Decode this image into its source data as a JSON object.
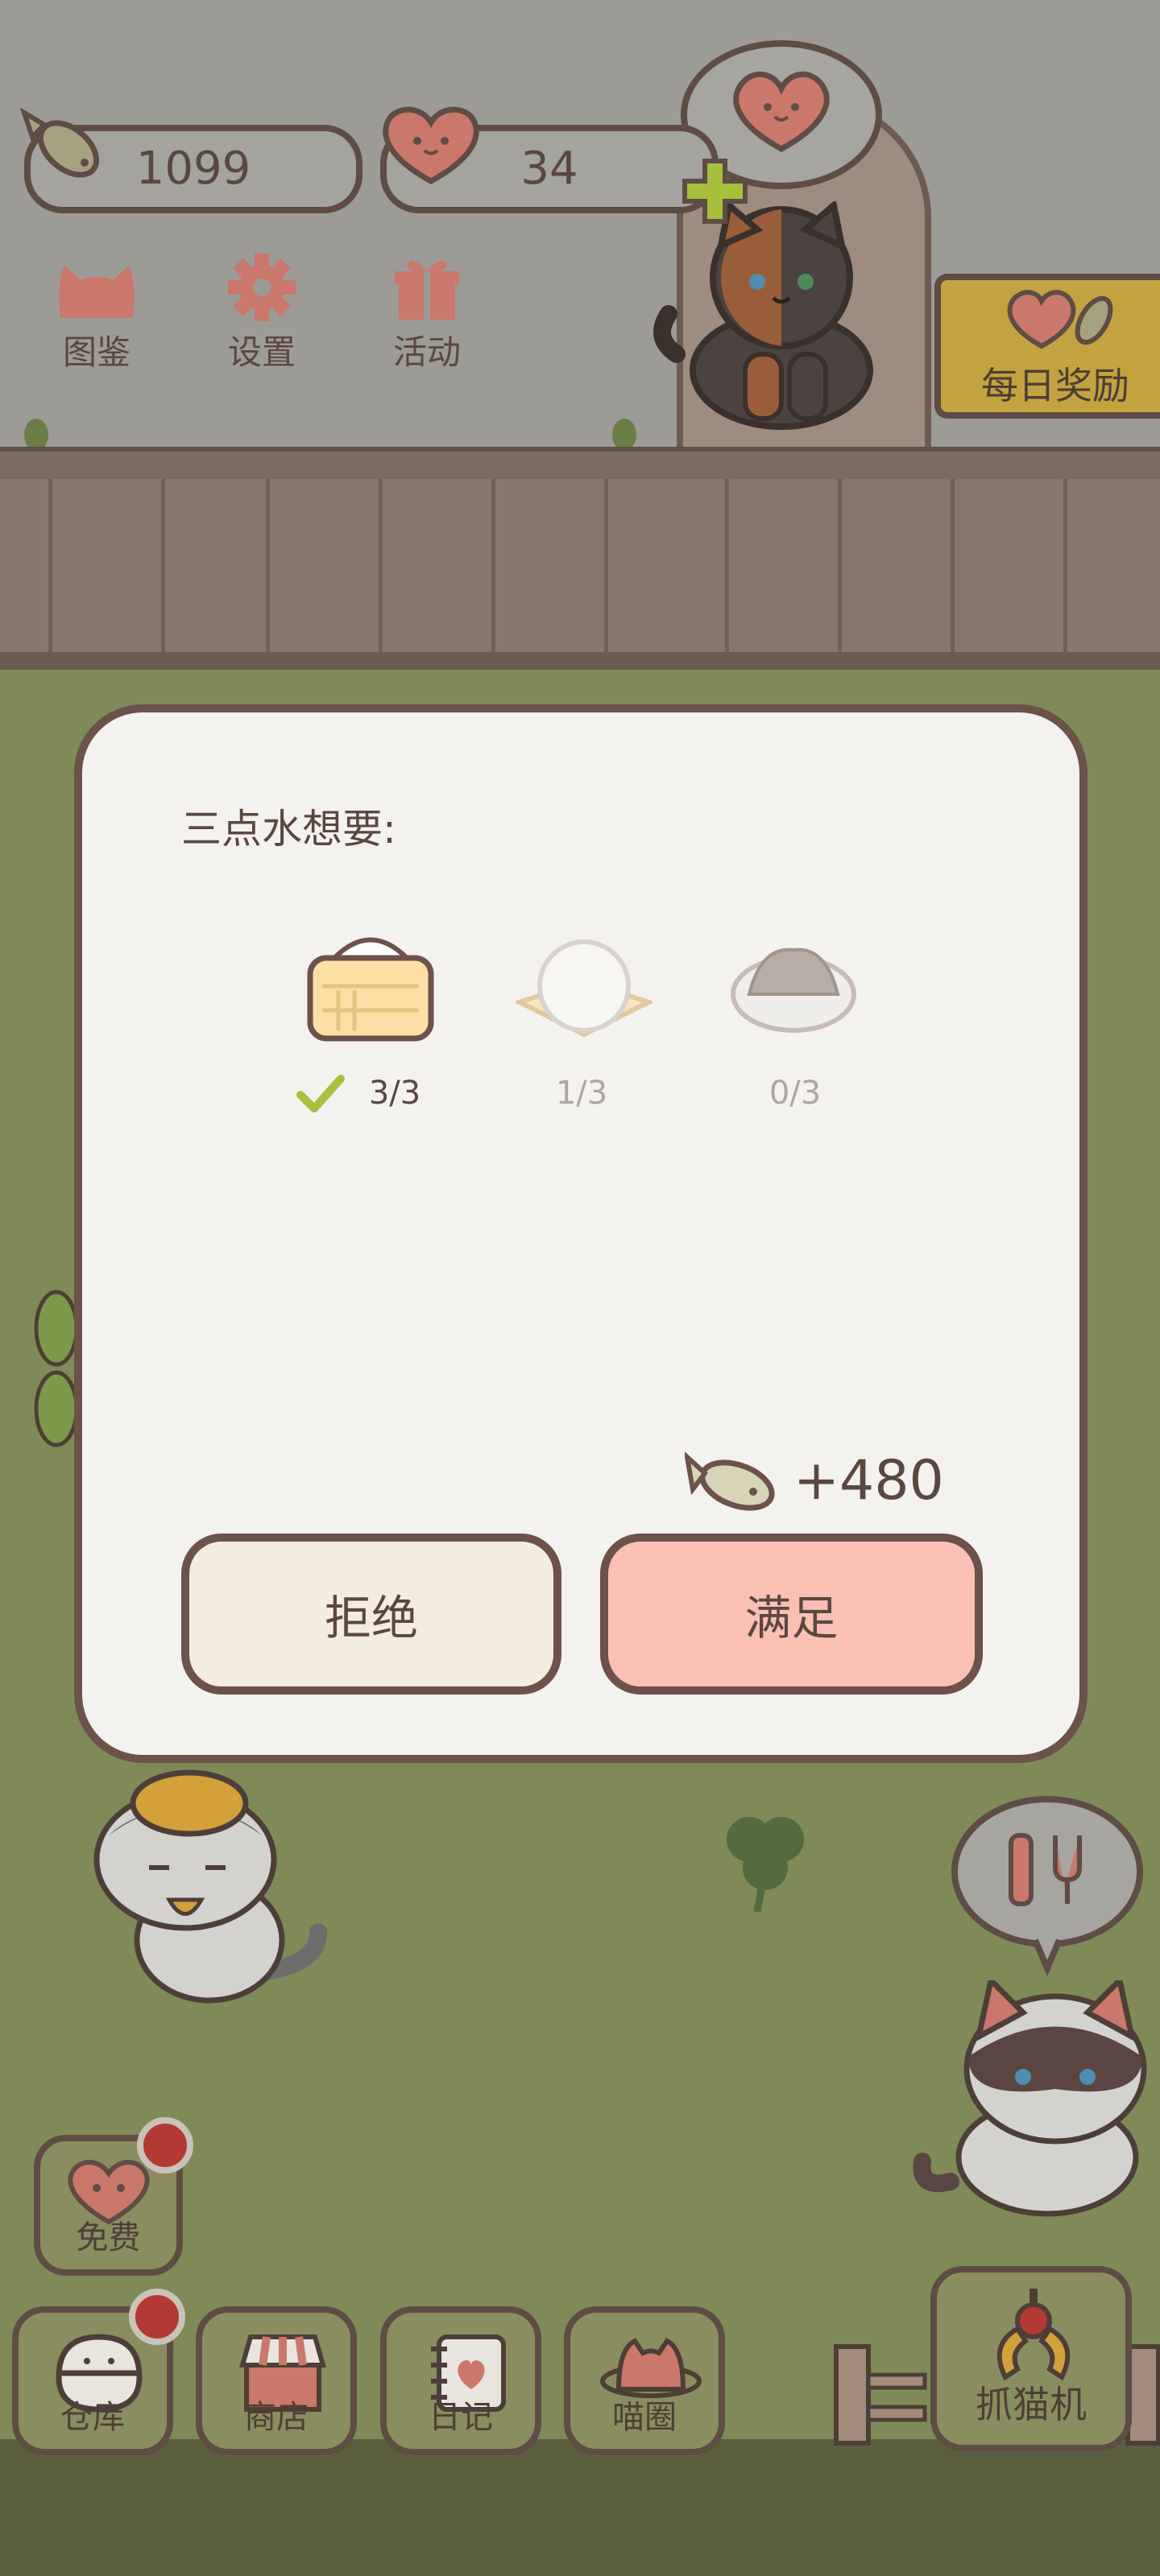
{
  "hud": {
    "fish_count": "1099",
    "heart_count": "34"
  },
  "menu": [
    {
      "label": "图鉴",
      "icon": "cat-book-icon"
    },
    {
      "label": "设置",
      "icon": "gear-icon"
    },
    {
      "label": "活动",
      "icon": "gift-icon"
    }
  ],
  "daily_reward": {
    "label": "每日奖励"
  },
  "request": {
    "title": "三点水想要:",
    "items": [
      {
        "icon": "steamed-bun-basket-icon",
        "progress": "3/3",
        "done": true
      },
      {
        "icon": "rice-cake-icon",
        "progress": "1/3",
        "done": false
      },
      {
        "icon": "fried-rice-plate-icon",
        "progress": "0/3",
        "done": false
      }
    ],
    "reward": "+480",
    "reject_label": "拒绝",
    "accept_label": "满足"
  },
  "free": {
    "label": "免费"
  },
  "nav": [
    {
      "label": "仓库",
      "icon": "warehouse-icon",
      "badge": true
    },
    {
      "label": "商店",
      "icon": "shop-icon",
      "badge": false
    },
    {
      "label": "日记",
      "icon": "diary-icon",
      "badge": false
    },
    {
      "label": "喵圈",
      "icon": "cat-planet-icon",
      "badge": false
    }
  ],
  "claw_machine": {
    "label": "抓猫机"
  },
  "colors": {
    "outline": "#6d514b",
    "accept_button": "#fbbfb4",
    "reject_button": "#f4ecde",
    "check": "#a7c03f",
    "heart": "#c9786b"
  }
}
